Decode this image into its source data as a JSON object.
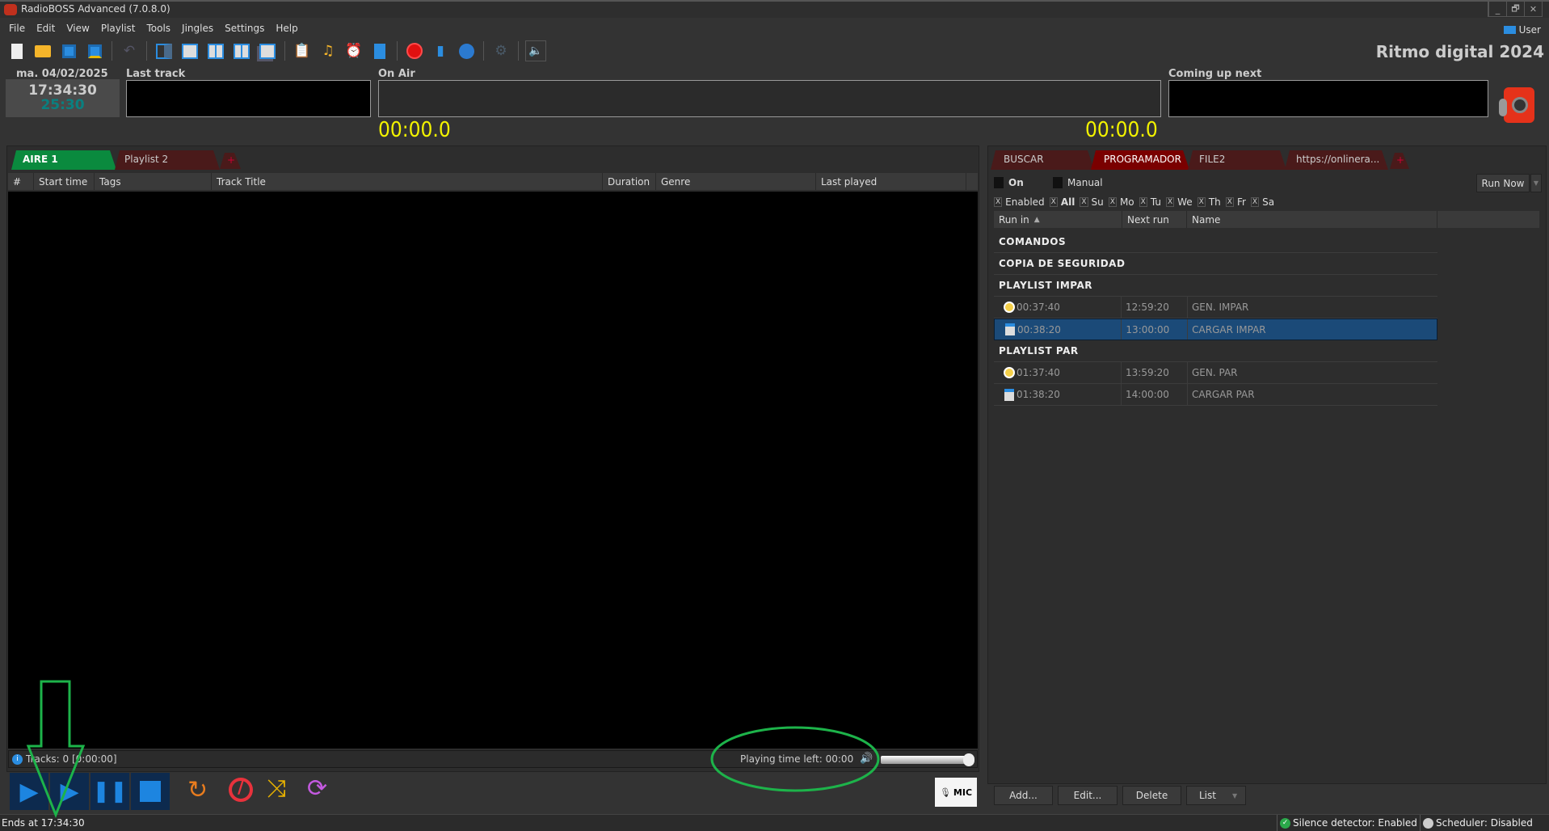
{
  "window": {
    "title": "RadioBOSS Advanced (7.0.8.0)",
    "controls": [
      "_",
      "🗗",
      "✕"
    ]
  },
  "menu": [
    "File",
    "Edit",
    "View",
    "Playlist",
    "Tools",
    "Jingles",
    "Settings",
    "Help"
  ],
  "toolbar_icons": [
    "new-icon",
    "open-icon",
    "save-icon",
    "save-as-icon",
    "undo-icon",
    "layout1-icon",
    "layout2-icon",
    "layout3-icon",
    "layout4-icon",
    "layout5-icon",
    "report-icon",
    "music-folder-icon",
    "scheduler-icon",
    "notes-icon",
    "record-icon",
    "stats-icon",
    "globe-icon",
    "settings-icon",
    "mute-icon"
  ],
  "user": {
    "label": "User"
  },
  "station": "Ritmo digital 2024",
  "clock": {
    "date": "ma. 04/02/2025",
    "time": "17:34:30",
    "countdown": "25:30"
  },
  "panels": {
    "last_track": "Last track",
    "on_air": "On Air",
    "coming_up": "Coming up next",
    "elapsed": "00:00.0",
    "remaining": "00:00.0"
  },
  "playlist": {
    "tabs": [
      {
        "label": "AIRE 1",
        "active": true
      },
      {
        "label": "Playlist 2"
      }
    ],
    "add_tab": "+",
    "columns": [
      "#",
      "Start time",
      "Tags",
      "Track Title",
      "Duration",
      "Genre",
      "Last played"
    ],
    "info": "Tracks: 0 [0:00:00]",
    "time_left": "Playing time left: 00:00",
    "volume": 1.0,
    "mic": "MIC"
  },
  "right": {
    "tabs": [
      {
        "label": "BUSCAR"
      },
      {
        "label": "PROGRAMADOR",
        "active": true
      },
      {
        "label": "FILE2"
      },
      {
        "label": "https://onlinera..."
      }
    ],
    "on_label": "On",
    "manual_label": "Manual",
    "run_now": "Run Now",
    "filters": [
      "Enabled",
      "All",
      "Su",
      "Mo",
      "Tu",
      "We",
      "Th",
      "Fr",
      "Sa"
    ],
    "columns": [
      "Run in",
      "Next run",
      "Name"
    ],
    "rows": [
      {
        "group": "COMANDOS"
      },
      {
        "group": "COPIA DE SEGURIDAD"
      },
      {
        "group": "PLAYLIST IMPAR"
      },
      {
        "run_in": "00:37:40",
        "next": "12:59:20",
        "name": "GEN. IMPAR",
        "icon": "clock-icon"
      },
      {
        "run_in": "00:38:20",
        "next": "13:00:00",
        "name": "CARGAR IMPAR",
        "icon": "playlist-clock-icon",
        "selected": true
      },
      {
        "group": "PLAYLIST PAR"
      },
      {
        "run_in": "01:37:40",
        "next": "13:59:20",
        "name": "GEN. PAR",
        "icon": "clock-icon"
      },
      {
        "run_in": "01:38:20",
        "next": "14:00:00",
        "name": "CARGAR PAR",
        "icon": "playlist-clock-icon"
      }
    ],
    "buttons": {
      "add": "Add...",
      "edit": "Edit...",
      "delete": "Delete",
      "list": "List"
    }
  },
  "statusbar": {
    "ends": "Ends at 17:34:30",
    "silence": "Silence detector: Enabled",
    "scheduler": "Scheduler: Disabled"
  },
  "colors": {
    "active_tab": "#0a8a3e",
    "inactive_tab": "#4a1a1a",
    "prog_tab": "#7a0000",
    "selection": "#1b4a78",
    "timer": "#f2f200",
    "annotation": "#1db34a"
  }
}
